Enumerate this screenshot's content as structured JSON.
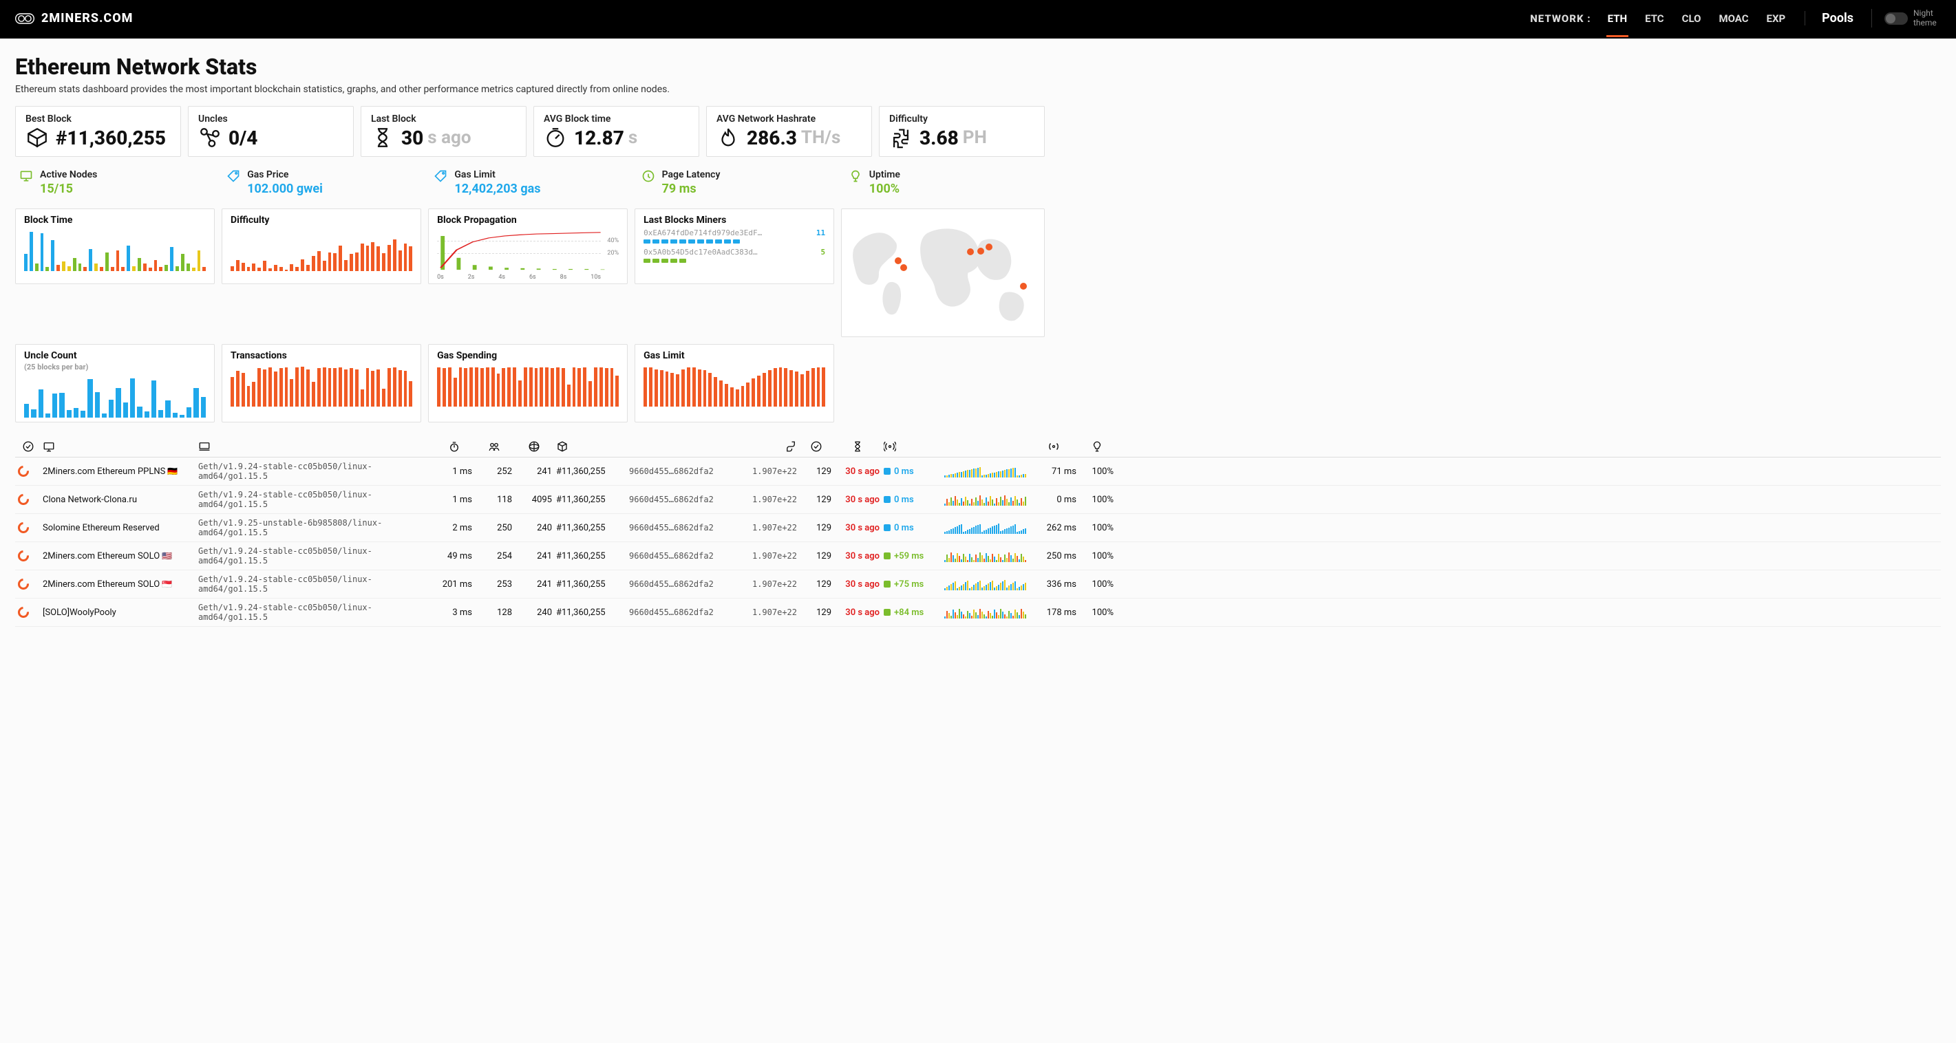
{
  "header": {
    "brand": "2MINERS.COM",
    "network_label": "NETWORK :",
    "networks": [
      "ETH",
      "ETC",
      "CLO",
      "MOAC",
      "EXP"
    ],
    "active_network": "ETH",
    "pools_label": "Pools",
    "theme_label": "Night theme"
  },
  "page": {
    "title": "Ethereum Network Stats",
    "subtitle": "Ethereum stats dashboard provides the most important blockchain statistics, graphs, and other performance metrics captured directly from online nodes."
  },
  "stats_primary": [
    {
      "label": "Best Block",
      "prefix": "#",
      "value": "11,360,255",
      "unit": "",
      "icon": "cube"
    },
    {
      "label": "Uncles",
      "prefix": "",
      "value": "0/4",
      "unit": "",
      "icon": "branch"
    },
    {
      "label": "Last Block",
      "prefix": "",
      "value": "30",
      "unit": "s ago",
      "icon": "hourglass"
    },
    {
      "label": "AVG Block time",
      "prefix": "",
      "value": "12.87",
      "unit": "s",
      "icon": "timer"
    },
    {
      "label": "AVG Network Hashrate",
      "prefix": "",
      "value": "286.3",
      "unit": "TH/s",
      "icon": "flame"
    },
    {
      "label": "Difficulty",
      "prefix": "",
      "value": "3.68",
      "unit": "PH",
      "icon": "puzzle"
    }
  ],
  "stats_secondary": [
    {
      "label": "Active Nodes",
      "value": "15/15",
      "color": "green",
      "icon": "monitor"
    },
    {
      "label": "Gas Price",
      "value": "102.000 gwei",
      "color": "blue",
      "icon": "tag"
    },
    {
      "label": "Gas Limit",
      "value": "12,402,203 gas",
      "color": "blue",
      "icon": "tag"
    },
    {
      "label": "Page Latency",
      "value": "79 ms",
      "color": "green",
      "icon": "clock"
    },
    {
      "label": "Uptime",
      "value": "100%",
      "color": "green",
      "icon": "bulb"
    }
  ],
  "mini_charts": {
    "block_time": {
      "label": "Block Time"
    },
    "difficulty": {
      "label": "Difficulty"
    },
    "block_propagation": {
      "label": "Block Propagation",
      "y_ticks": [
        "40%",
        "20%"
      ],
      "x_ticks": [
        "0s",
        "2s",
        "4s",
        "6s",
        "8s",
        "10s"
      ]
    },
    "last_miners": {
      "label": "Last Blocks Miners",
      "rows": [
        {
          "addr": "0xEA674fdDe714fd979de3EdF…",
          "count": 11,
          "dots": 11,
          "color": "blue"
        },
        {
          "addr": "0x5A0b54D5dc17e0AadC383d…",
          "count": 5,
          "dots": 5,
          "color": "green"
        }
      ]
    },
    "uncle_count": {
      "label": "Uncle Count",
      "sub": "(25 blocks per bar)"
    },
    "transactions": {
      "label": "Transactions"
    },
    "gas_spending": {
      "label": "Gas Spending"
    },
    "gas_limit": {
      "label": "Gas Limit"
    }
  },
  "chart_data": {
    "block_time": {
      "type": "bar",
      "colors": [
        "or",
        "bl",
        "gr",
        "yl"
      ],
      "values": [
        40,
        92,
        18,
        88,
        10,
        72,
        14,
        22,
        12,
        30,
        18,
        10,
        52,
        18,
        10,
        44,
        10,
        48,
        10,
        60,
        12,
        30,
        18,
        8,
        26,
        10,
        14,
        56,
        12,
        40,
        18,
        8,
        48,
        10
      ],
      "color_idx": [
        1,
        1,
        2,
        1,
        2,
        1,
        0,
        3,
        3,
        2,
        2,
        0,
        1,
        3,
        0,
        2,
        0,
        0,
        0,
        1,
        3,
        2,
        0,
        0,
        0,
        0,
        2,
        1,
        2,
        2,
        2,
        3,
        3,
        0
      ]
    },
    "difficulty": {
      "type": "bar",
      "values": [
        12,
        26,
        20,
        10,
        18,
        8,
        24,
        6,
        14,
        10,
        4,
        16,
        10,
        28,
        14,
        36,
        46,
        24,
        44,
        42,
        60,
        26,
        40,
        44,
        64,
        60,
        68,
        58,
        42,
        62,
        74,
        48,
        64,
        58
      ]
    },
    "block_propagation": {
      "type": "line",
      "x": [
        0,
        1,
        2,
        3,
        4,
        5,
        6,
        7,
        8,
        9,
        10
      ],
      "bars": [
        85,
        30,
        12,
        8,
        5,
        4,
        3,
        2,
        2,
        2,
        1
      ],
      "line": [
        5,
        50,
        70,
        80,
        85,
        88,
        90,
        91,
        92,
        93,
        94
      ]
    },
    "uncle_count": {
      "type": "bar",
      "values": [
        32,
        20,
        66,
        10,
        56,
        58,
        18,
        22,
        16,
        90,
        60,
        10,
        42,
        70,
        36,
        92,
        26,
        14,
        88,
        18,
        40,
        12,
        6,
        24,
        70,
        48
      ]
    },
    "transactions": {
      "type": "bar",
      "values": [
        70,
        84,
        80,
        48,
        58,
        90,
        88,
        92,
        82,
        90,
        92,
        64,
        92,
        94,
        88,
        58,
        90,
        92,
        90,
        90,
        92,
        88,
        90,
        88,
        40,
        90,
        84,
        88,
        42,
        90,
        92,
        86,
        84,
        60
      ]
    },
    "gas_spending": {
      "type": "bar",
      "values": [
        92,
        90,
        92,
        68,
        92,
        90,
        92,
        92,
        90,
        92,
        92,
        78,
        90,
        92,
        92,
        62,
        92,
        92,
        90,
        92,
        92,
        90,
        92,
        90,
        52,
        92,
        90,
        92,
        60,
        92,
        92,
        90,
        90,
        72
      ]
    },
    "gas_limit": {
      "type": "bar",
      "values": [
        92,
        92,
        88,
        86,
        82,
        80,
        76,
        88,
        92,
        92,
        88,
        86,
        80,
        70,
        62,
        54,
        46,
        40,
        48,
        56,
        66,
        72,
        80,
        86,
        90,
        92,
        90,
        86,
        82,
        76,
        84,
        90,
        92,
        92
      ]
    }
  },
  "table": {
    "headers_icons": [
      "check",
      "monitor",
      "laptop",
      "stopwatch",
      "people",
      "planet",
      "cube",
      "diff",
      "check2",
      "hourglass",
      "signal",
      "",
      "signal2",
      "bulb"
    ],
    "rows": [
      {
        "name": "2Miners.com Ethereum PPLNS",
        "flag": "🇩🇪",
        "client": "Geth/v1.9.24-stable-cc05b050/linux-amd64/go1.15.5",
        "lat": "1 ms",
        "peers": 252,
        "pend": 241,
        "block": "#11,360,255",
        "hash": "9660d455…6862dfa2",
        "diff": "1.907e+22",
        "txs": 129,
        "blk_time": "30 s ago",
        "prop": {
          "sq": "blue",
          "txt": "0 ms",
          "txt_color": "blue"
        },
        "avg": "71 ms",
        "up": "100%"
      },
      {
        "name": "Clona Network-Clona.ru",
        "flag": "",
        "client": "Geth/v1.9.24-stable-cc05b050/linux-amd64/go1.15.5",
        "lat": "1 ms",
        "peers": 118,
        "pend": 4095,
        "block": "#11,360,255",
        "hash": "9660d455…6862dfa2",
        "diff": "1.907e+22",
        "txs": 129,
        "blk_time": "30 s ago",
        "prop": {
          "sq": "blue",
          "txt": "0 ms",
          "txt_color": "blue"
        },
        "avg": "0 ms",
        "up": "100%"
      },
      {
        "name": "Solomine Ethereum Reserved",
        "flag": "",
        "client": "Geth/v1.9.25-unstable-6b985808/linux-amd64/go1.15.5",
        "lat": "2 ms",
        "peers": 250,
        "pend": 240,
        "block": "#11,360,255",
        "hash": "9660d455…6862dfa2",
        "diff": "1.907e+22",
        "txs": 129,
        "blk_time": "30 s ago",
        "prop": {
          "sq": "blue",
          "txt": "0 ms",
          "txt_color": "blue"
        },
        "avg": "262 ms",
        "up": "100%"
      },
      {
        "name": "2Miners.com Ethereum SOLO",
        "flag": "🇺🇸",
        "client": "Geth/v1.9.24-stable-cc05b050/linux-amd64/go1.15.5",
        "lat": "49 ms",
        "peers": 254,
        "pend": 241,
        "block": "#11,360,255",
        "hash": "9660d455…6862dfa2",
        "diff": "1.907e+22",
        "txs": 129,
        "blk_time": "30 s ago",
        "prop": {
          "sq": "green",
          "txt": "+59 ms",
          "txt_color": "green"
        },
        "avg": "250 ms",
        "up": "100%"
      },
      {
        "name": "2Miners.com Ethereum SOLO",
        "flag": "🇸🇬",
        "client": "Geth/v1.9.24-stable-cc05b050/linux-amd64/go1.15.5",
        "lat": "201 ms",
        "peers": 253,
        "pend": 241,
        "block": "#11,360,255",
        "hash": "9660d455…6862dfa2",
        "diff": "1.907e+22",
        "txs": 129,
        "blk_time": "30 s ago",
        "prop": {
          "sq": "green",
          "txt": "+75 ms",
          "txt_color": "green"
        },
        "avg": "336 ms",
        "up": "100%"
      },
      {
        "name": "[SOLO]WoolyPooly",
        "flag": "",
        "client": "Geth/v1.9.24-stable-cc05b050/linux-amd64/go1.15.5",
        "lat": "3 ms",
        "peers": 128,
        "pend": 240,
        "block": "#11,360,255",
        "hash": "9660d455…6862dfa2",
        "diff": "1.907e+22",
        "txs": 129,
        "blk_time": "30 s ago",
        "prop": {
          "sq": "green",
          "txt": "+84 ms",
          "txt_color": "green"
        },
        "avg": "178 ms",
        "up": "100%"
      }
    ]
  },
  "map_pins": [
    [
      26,
      38
    ],
    [
      29,
      43
    ],
    [
      62,
      31
    ],
    [
      67,
      30
    ],
    [
      71,
      27
    ],
    [
      88,
      58
    ]
  ]
}
